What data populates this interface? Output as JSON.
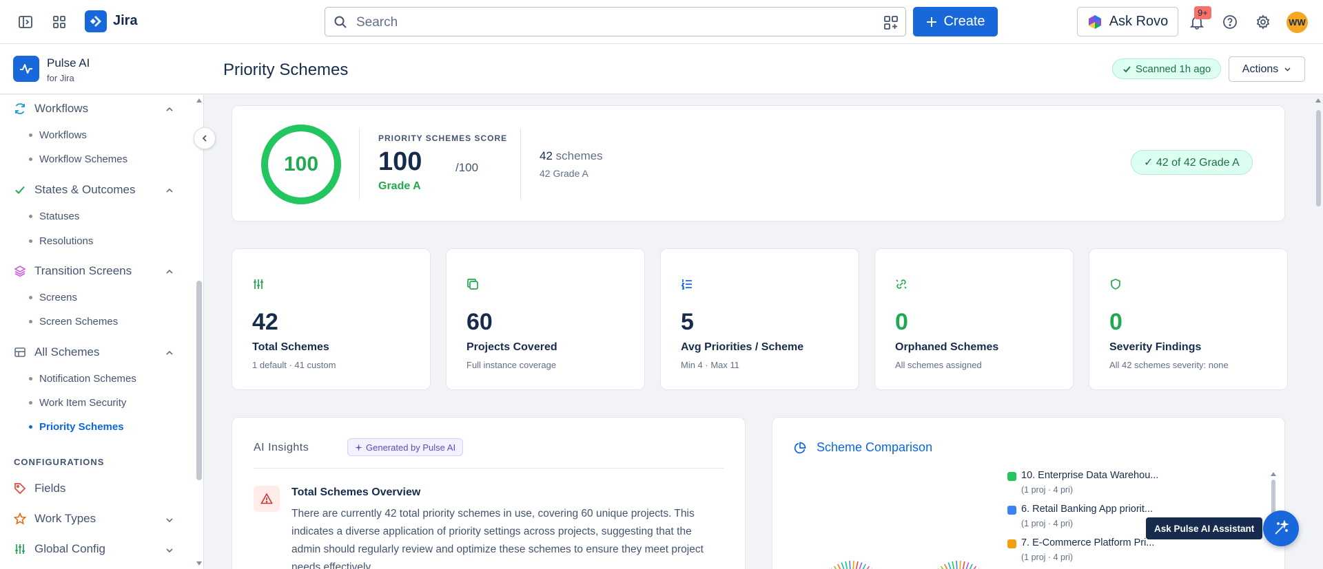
{
  "topbar": {
    "app_name": "Jira",
    "search_placeholder": "Search",
    "create_label": "Create",
    "ask_rovo_label": "Ask Rovo",
    "notification_badge": "9+",
    "avatar_initials": "WW"
  },
  "app": {
    "name": "Pulse AI",
    "subtitle": "for Jira"
  },
  "header": {
    "title": "Priority Schemes",
    "scanned_label": "Scanned 1h ago",
    "actions_label": "Actions"
  },
  "sidebar": {
    "sections": [
      {
        "label": "Workflows",
        "icon": "refresh-icon",
        "items": [
          "Workflows",
          "Workflow Schemes"
        ]
      },
      {
        "label": "States & Outcomes",
        "icon": "check-icon",
        "items": [
          "Statuses",
          "Resolutions"
        ]
      },
      {
        "label": "Transition Screens",
        "icon": "layers-icon",
        "items": [
          "Screens",
          "Screen Schemes"
        ]
      },
      {
        "label": "All Schemes",
        "icon": "table-icon",
        "items": [
          "Notification Schemes",
          "Work Item Security",
          "Priority Schemes"
        ]
      }
    ],
    "active_item": "Priority Schemes",
    "group_label": "CONFIGURATIONS",
    "config_items": [
      {
        "label": "Fields",
        "icon": "tag-icon"
      },
      {
        "label": "Work Types",
        "icon": "star-icon"
      },
      {
        "label": "Global Config",
        "icon": "sliders-icon"
      }
    ]
  },
  "score": {
    "ring_value": "100",
    "label": "PRIORITY SCHEMES SCORE",
    "value": "100",
    "max": "/100",
    "grade": "Grade A",
    "schemes_count": "42",
    "schemes_word": "schemes",
    "schemes_sub": "42 Grade A",
    "grade_pill": "✓ 42 of 42 Grade A",
    "score_fraction": 1.0
  },
  "stats": [
    {
      "icon": "sliders-icon",
      "value": "42",
      "label": "Total Schemes",
      "sub": "1 default · 41 custom",
      "green": false,
      "color": "#22a94f"
    },
    {
      "icon": "copy-icon",
      "value": "60",
      "label": "Projects Covered",
      "sub": "Full instance coverage",
      "green": false,
      "color": "#22a94f"
    },
    {
      "icon": "list-ordered-icon",
      "value": "5",
      "label": "Avg Priorities / Scheme",
      "sub": "Min 4 · Max 11",
      "green": false,
      "color": "#0c66e4"
    },
    {
      "icon": "unlink-icon",
      "value": "0",
      "label": "Orphaned Schemes",
      "sub": "All schemes assigned",
      "green": true,
      "color": "#22a94f"
    },
    {
      "icon": "shield-icon",
      "value": "0",
      "label": "Severity Findings",
      "sub": "All 42 schemes severity: none",
      "green": true,
      "color": "#22a94f"
    }
  ],
  "insights": {
    "title": "AI Insights",
    "badge": "Generated by Pulse AI",
    "heading": "Total Schemes Overview",
    "body": "There are currently 42 total priority schemes in use, covering 60 unique projects. This indicates a diverse application of priority settings across projects, suggesting that the admin should regularly review and optimize these schemes to ensure they meet project needs effectively."
  },
  "comparison": {
    "title": "Scheme Comparison",
    "legend": [
      {
        "name": "10. Enterprise Data Warehou...",
        "sub": "(1 proj · 4 pri)",
        "color": "#22c55e"
      },
      {
        "name": "6. Retail Banking App priorit...",
        "sub": "(1 proj · 4 pri)",
        "color": "#3b82f6"
      },
      {
        "name": "7. E-Commerce Platform Pri...",
        "sub": "(1 proj · 4 pri)",
        "color": "#f59e0b"
      }
    ]
  },
  "assistant": {
    "tooltip": "Ask Pulse AI Assistant"
  }
}
